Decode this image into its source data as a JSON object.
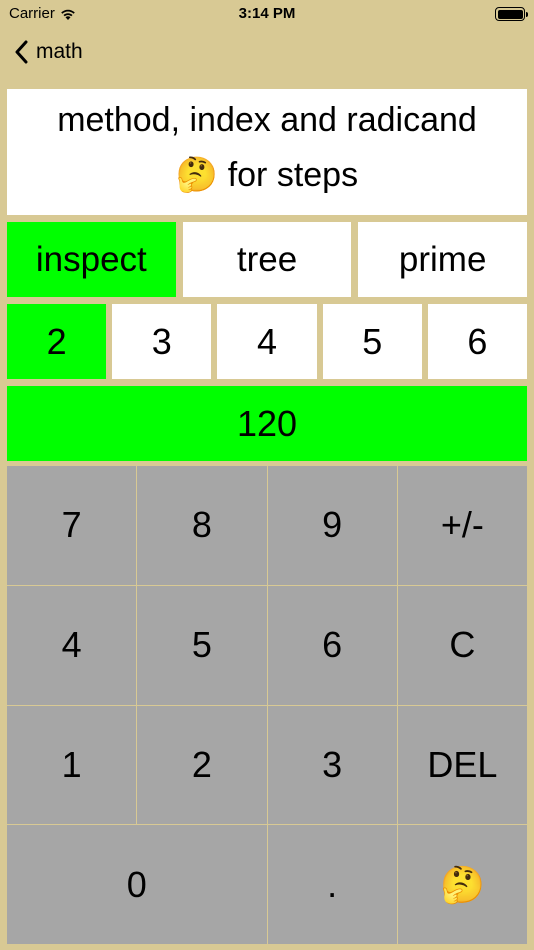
{
  "status": {
    "carrier": "Carrier",
    "time": "3:14 PM"
  },
  "nav": {
    "back_label": "math"
  },
  "info": {
    "line1": "method, index and radicand",
    "line2_emoji": "🤔",
    "line2_text": "for steps"
  },
  "methods": {
    "items": [
      "inspect",
      "tree",
      "prime"
    ],
    "selected": "inspect"
  },
  "indices": {
    "items": [
      "2",
      "3",
      "4",
      "5",
      "6"
    ],
    "selected": "2"
  },
  "radicand": {
    "value": "120"
  },
  "keypad": {
    "k7": "7",
    "k8": "8",
    "k9": "9",
    "sign": "+/-",
    "k4": "4",
    "k5": "5",
    "k6": "6",
    "clear": "C",
    "k1": "1",
    "k2": "2",
    "k3": "3",
    "del": "DEL",
    "k0": "0",
    "dot": ".",
    "think": "🤔"
  },
  "colors": {
    "background": "#d8c994",
    "active": "#00ff00",
    "key": "#a6a6a6",
    "panel": "#ffffff"
  }
}
